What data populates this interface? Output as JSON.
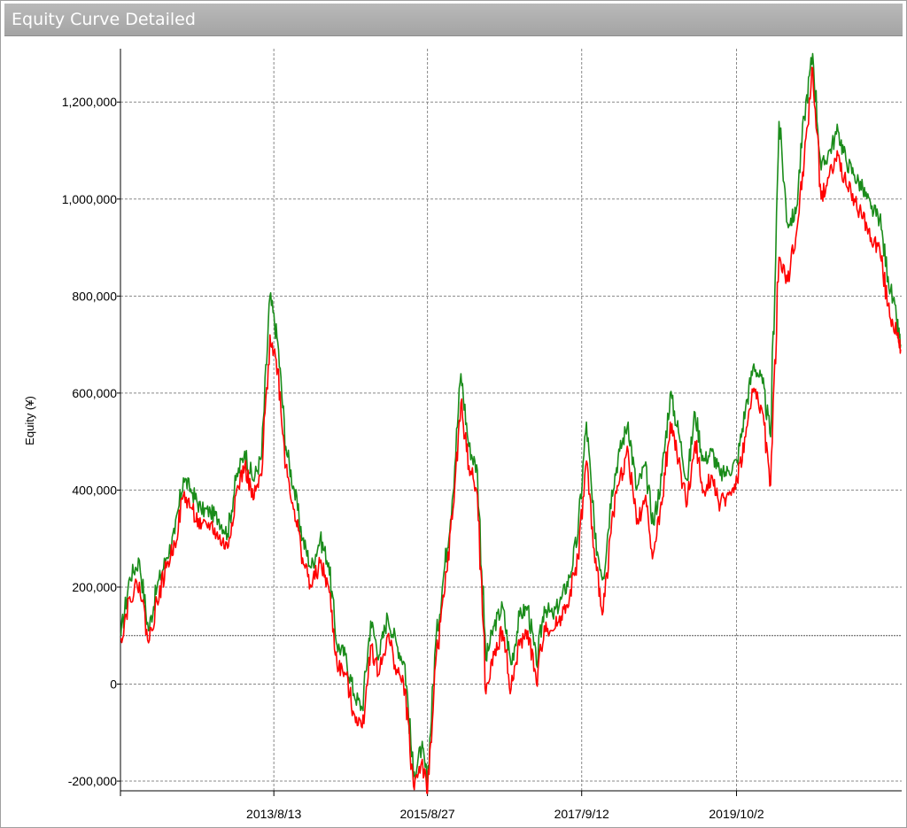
{
  "panel": {
    "title": "Equity Curve Detailed"
  },
  "chart_data": {
    "type": "line",
    "title": "Equity Curve Detailed",
    "xlabel": "",
    "ylabel": "Equity (¥)",
    "ylim": [
      -220000,
      1310000
    ],
    "xlim": [
      "2011-08-01",
      "2021-12-10"
    ],
    "y_ticks": [
      -200000,
      0,
      200000,
      400000,
      600000,
      800000,
      1000000,
      1200000
    ],
    "y_tick_labels": [
      "-200,000",
      "0",
      "200,000",
      "400,000",
      "600,000",
      "800,000",
      "1,000,000",
      "1,200,000"
    ],
    "x_ticks": [
      "2013-08-13",
      "2015-08-27",
      "2017-09-12",
      "2019-10-02"
    ],
    "x_tick_labels": [
      "2013/8/13",
      "2015/8/27",
      "2017/9/12",
      "2019/10/2"
    ],
    "reference_line": 100000,
    "grid": true,
    "colors": {
      "high": "#1a8c1a",
      "low": "#ff0000",
      "grid": "#888888",
      "reference": "#555555"
    },
    "series": [
      {
        "key": "high",
        "x": [
          "2011-08-03",
          "2011-09-15",
          "2011-11-01",
          "2011-12-15",
          "2012-01-25",
          "2012-03-10",
          "2012-04-20",
          "2012-06-01",
          "2012-07-15",
          "2012-08-25",
          "2012-10-10",
          "2012-11-20",
          "2013-01-01",
          "2013-02-10",
          "2013-03-25",
          "2013-05-05",
          "2013-06-15",
          "2013-07-25",
          "2013-09-01",
          "2013-10-10",
          "2013-11-20",
          "2013-12-30",
          "2014-02-10",
          "2014-03-25",
          "2014-05-05",
          "2014-06-15",
          "2014-07-25",
          "2014-09-05",
          "2014-10-15",
          "2014-11-25",
          "2015-01-05",
          "2015-02-15",
          "2015-04-01",
          "2015-05-10",
          "2015-06-20",
          "2015-07-30",
          "2015-08-27",
          "2015-10-05",
          "2015-11-15",
          "2015-12-25",
          "2016-02-05",
          "2016-03-15",
          "2016-04-25",
          "2016-06-05",
          "2016-07-15",
          "2016-08-25",
          "2016-10-05",
          "2016-11-15",
          "2016-12-25",
          "2017-02-05",
          "2017-03-15",
          "2017-04-25",
          "2017-06-05",
          "2017-07-15",
          "2017-08-25",
          "2017-10-05",
          "2017-11-15",
          "2017-12-25",
          "2018-02-05",
          "2018-03-15",
          "2018-04-25",
          "2018-06-05",
          "2018-07-15",
          "2018-08-25",
          "2018-10-05",
          "2018-11-15",
          "2018-12-25",
          "2019-02-05",
          "2019-03-15",
          "2019-04-25",
          "2019-06-05",
          "2019-07-15",
          "2019-08-25",
          "2019-10-05",
          "2019-11-15",
          "2019-12-25",
          "2020-02-05",
          "2020-03-15",
          "2020-04-25",
          "2020-06-05",
          "2020-07-15",
          "2020-08-25",
          "2020-10-05",
          "2020-11-15",
          "2020-12-25",
          "2021-02-05",
          "2021-03-15",
          "2021-04-25",
          "2021-06-05",
          "2021-07-15",
          "2021-08-25",
          "2021-10-05",
          "2021-11-15",
          "2021-12-05"
        ],
        "values": [
          100000,
          220000,
          255000,
          110000,
          200000,
          260000,
          310000,
          425000,
          395000,
          360000,
          355000,
          340000,
          310000,
          420000,
          480000,
          420000,
          470000,
          800000,
          705000,
          490000,
          400000,
          300000,
          240000,
          300000,
          250000,
          80000,
          60000,
          -20000,
          -50000,
          130000,
          60000,
          140000,
          80000,
          40000,
          -190000,
          -130000,
          -200000,
          80000,
          230000,
          380000,
          640000,
          490000,
          440000,
          50000,
          120000,
          160000,
          40000,
          140000,
          160000,
          40000,
          160000,
          140000,
          175000,
          220000,
          310000,
          540000,
          300000,
          220000,
          400000,
          480000,
          540000,
          400000,
          450000,
          330000,
          430000,
          600000,
          520000,
          420000,
          560000,
          460000,
          480000,
          430000,
          440000,
          460000,
          570000,
          660000,
          620000,
          510000,
          1160000,
          950000,
          970000,
          1170000,
          1300000,
          1060000,
          1100000,
          1140000,
          1080000,
          1050000,
          1020000,
          980000,
          960000,
          840000,
          750000,
          700000
        ]
      },
      {
        "key": "low",
        "x": [
          "2011-08-03",
          "2011-09-15",
          "2011-11-01",
          "2011-12-15",
          "2012-01-25",
          "2012-03-10",
          "2012-04-20",
          "2012-06-01",
          "2012-07-15",
          "2012-08-25",
          "2012-10-10",
          "2012-11-20",
          "2013-01-01",
          "2013-02-10",
          "2013-03-25",
          "2013-05-05",
          "2013-06-15",
          "2013-07-25",
          "2013-09-01",
          "2013-10-10",
          "2013-11-20",
          "2013-12-30",
          "2014-02-10",
          "2014-03-25",
          "2014-05-05",
          "2014-06-15",
          "2014-07-25",
          "2014-09-05",
          "2014-10-15",
          "2014-11-25",
          "2015-01-05",
          "2015-02-15",
          "2015-04-01",
          "2015-05-10",
          "2015-06-20",
          "2015-07-30",
          "2015-08-27",
          "2015-10-05",
          "2015-11-15",
          "2015-12-25",
          "2016-02-05",
          "2016-03-15",
          "2016-04-25",
          "2016-06-05",
          "2016-07-15",
          "2016-08-25",
          "2016-10-05",
          "2016-11-15",
          "2016-12-25",
          "2017-02-05",
          "2017-03-15",
          "2017-04-25",
          "2017-06-05",
          "2017-07-15",
          "2017-08-25",
          "2017-10-05",
          "2017-11-15",
          "2017-12-25",
          "2018-02-05",
          "2018-03-15",
          "2018-04-25",
          "2018-06-05",
          "2018-07-15",
          "2018-08-25",
          "2018-10-05",
          "2018-11-15",
          "2018-12-25",
          "2019-02-05",
          "2019-03-15",
          "2019-04-25",
          "2019-06-05",
          "2019-07-15",
          "2019-08-25",
          "2019-10-05",
          "2019-11-15",
          "2019-12-25",
          "2020-02-05",
          "2020-03-15",
          "2020-04-25",
          "2020-06-05",
          "2020-07-15",
          "2020-08-25",
          "2020-10-05",
          "2020-11-15",
          "2020-12-25",
          "2021-02-05",
          "2021-03-15",
          "2021-04-25",
          "2021-06-05",
          "2021-07-15",
          "2021-08-25",
          "2021-10-05",
          "2021-11-15",
          "2021-12-05"
        ],
        "values": [
          95000,
          180000,
          210000,
          85000,
          170000,
          240000,
          290000,
          390000,
          360000,
          320000,
          330000,
          300000,
          280000,
          390000,
          450000,
          380000,
          430000,
          720000,
          650000,
          450000,
          360000,
          260000,
          200000,
          250000,
          200000,
          40000,
          20000,
          -60000,
          -90000,
          80000,
          20000,
          100000,
          30000,
          -10000,
          -210000,
          -160000,
          -225000,
          40000,
          180000,
          340000,
          580000,
          450000,
          390000,
          -20000,
          60000,
          110000,
          -10000,
          80000,
          110000,
          0,
          120000,
          110000,
          140000,
          180000,
          260000,
          460000,
          250000,
          150000,
          340000,
          420000,
          480000,
          330000,
          380000,
          270000,
          370000,
          540000,
          460000,
          370000,
          500000,
          400000,
          430000,
          370000,
          390000,
          420000,
          510000,
          610000,
          560000,
          410000,
          880000,
          830000,
          920000,
          1080000,
          1270000,
          1000000,
          1050000,
          1090000,
          1030000,
          1000000,
          960000,
          920000,
          900000,
          780000,
          720000,
          690000
        ]
      }
    ]
  }
}
